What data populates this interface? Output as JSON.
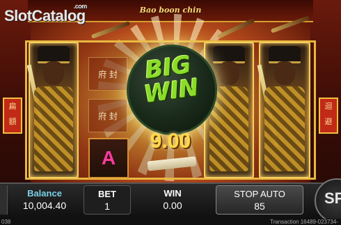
{
  "game": {
    "title": "Bao boon chin",
    "watermark": "SlotCatalog",
    "watermark_suffix": ".com"
  },
  "reels": {
    "symbols_left_reel2": [
      "府 封",
      "府 封"
    ],
    "letter_symbol": "A"
  },
  "big_win": {
    "label": "BIG WIN",
    "amount": "9.00"
  },
  "side_banners": {
    "left": [
      "扁",
      "額"
    ],
    "right": [
      "迴",
      "避"
    ]
  },
  "panel": {
    "balance_label": "Balance",
    "balance_value": "10,004.40",
    "bet_label": "BET",
    "bet_value": "1",
    "win_label": "WIN",
    "win_value": "0.00",
    "stop_auto_label": "STOP AUTO",
    "stop_auto_value": "85",
    "spin_label": "SP"
  },
  "footer": {
    "left_text": "038",
    "transaction_text": "Transaction 16489-023734-"
  },
  "colors": {
    "accent_gold": "#e8b840",
    "big_win_green": "#8adc28",
    "amount_gold": "#ffd84a",
    "balance_label": "#7ad0e8"
  }
}
